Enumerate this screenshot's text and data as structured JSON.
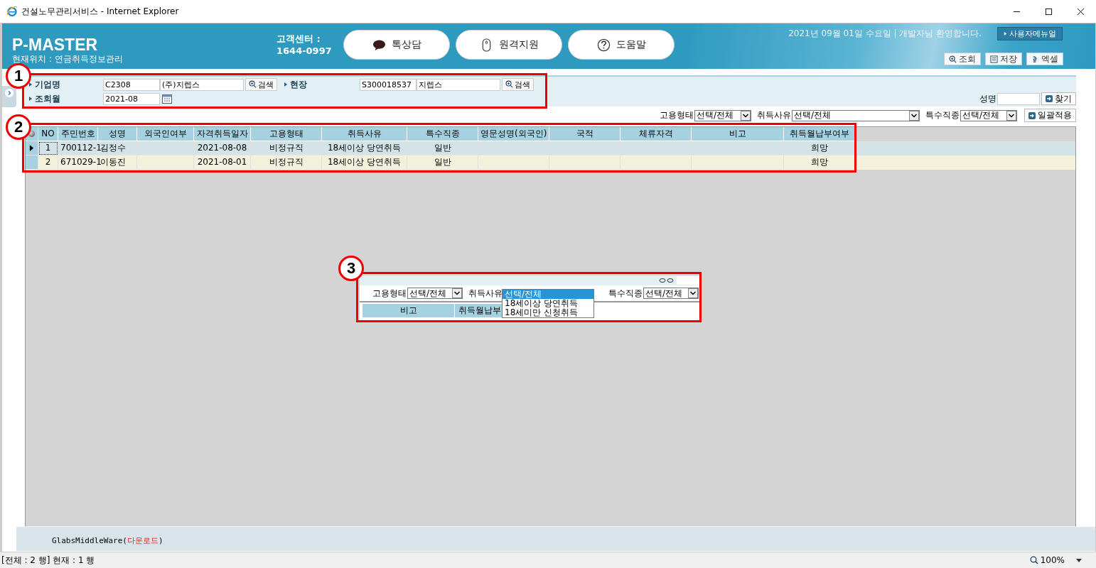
{
  "window": {
    "title": "건설노무관리서비스 - Internet Explorer"
  },
  "header": {
    "logo": "P-MASTER",
    "location": "현재위치 : 연금취득정보관리",
    "center_label": "고객센터 :",
    "center_phone": "1644-0997",
    "buttons": [
      {
        "label": "톡상담",
        "kind": "chat"
      },
      {
        "label": "원격지원",
        "kind": "mouse"
      },
      {
        "label": "도움말",
        "kind": "help"
      }
    ],
    "greeting": "2021년 09월 01일 수요일 | 개발자님 환영합니다.",
    "manual": "사용자메뉴얼",
    "actions": [
      {
        "label": "조회",
        "kind": "search"
      },
      {
        "label": "저장",
        "kind": "save"
      },
      {
        "label": "엑셀",
        "kind": "excel"
      }
    ]
  },
  "search": {
    "company_label": "기업명",
    "company_code": "C2308",
    "company_name": "(주)지렙스",
    "company_button": "검색",
    "site_label": "현장",
    "site_code": "S300018537",
    "site_name": "지렙스",
    "site_button": "검색",
    "month_label": "조회월",
    "month": "2021-08",
    "name_label": "성명",
    "find_button": "찾기"
  },
  "filters": [
    {
      "label": "고용형태",
      "value": "선택/전체"
    },
    {
      "label": "취득사유",
      "value": "선택/전체"
    },
    {
      "label": "특수직종",
      "value": "선택/전체"
    }
  ],
  "apply_button": "일괄적용",
  "grid": {
    "columns": [
      "NO",
      "주민번호",
      "성명",
      "외국인여부",
      "자격취득일자",
      "고용형태",
      "취득사유",
      "특수직종",
      "영문성명(외국인)",
      "국적",
      "체류자격",
      "비고",
      "취득월납부여부"
    ],
    "rows": [
      {
        "selected": true,
        "cells": [
          "1",
          "700112-1",
          "김정수",
          "",
          "2021-08-08",
          "비정규직",
          "18세이상 당연취득",
          "일반",
          "",
          "",
          "",
          "",
          "희망"
        ]
      },
      {
        "selected": false,
        "cells": [
          "2",
          "671029-1",
          "이동진",
          "",
          "2021-08-01",
          "비정규직",
          "18세이상 당연취득",
          "일반",
          "",
          "",
          "",
          "",
          "희망"
        ]
      }
    ]
  },
  "inset": {
    "filters": [
      {
        "label": "고용형태",
        "value": "선택/전체"
      },
      {
        "label": "취득사유"
      },
      {
        "label": "특수직종",
        "value": "선택/전체"
      }
    ],
    "options": [
      {
        "label": "선택/전체",
        "selected": true
      },
      {
        "label": "18세이상 당연취득",
        "selected": false
      },
      {
        "label": "18세미만 신청취득",
        "selected": false
      }
    ],
    "columns": [
      "비고",
      "취득월납부"
    ]
  },
  "footer": {
    "middleware": "GlabsMiddleWare(",
    "link": "다운로드",
    "close": ")"
  },
  "status": {
    "text": "[전체 : 2 행] 현재 : 1 행",
    "zoom": "100%"
  },
  "callouts": [
    "1",
    "2",
    "3"
  ]
}
